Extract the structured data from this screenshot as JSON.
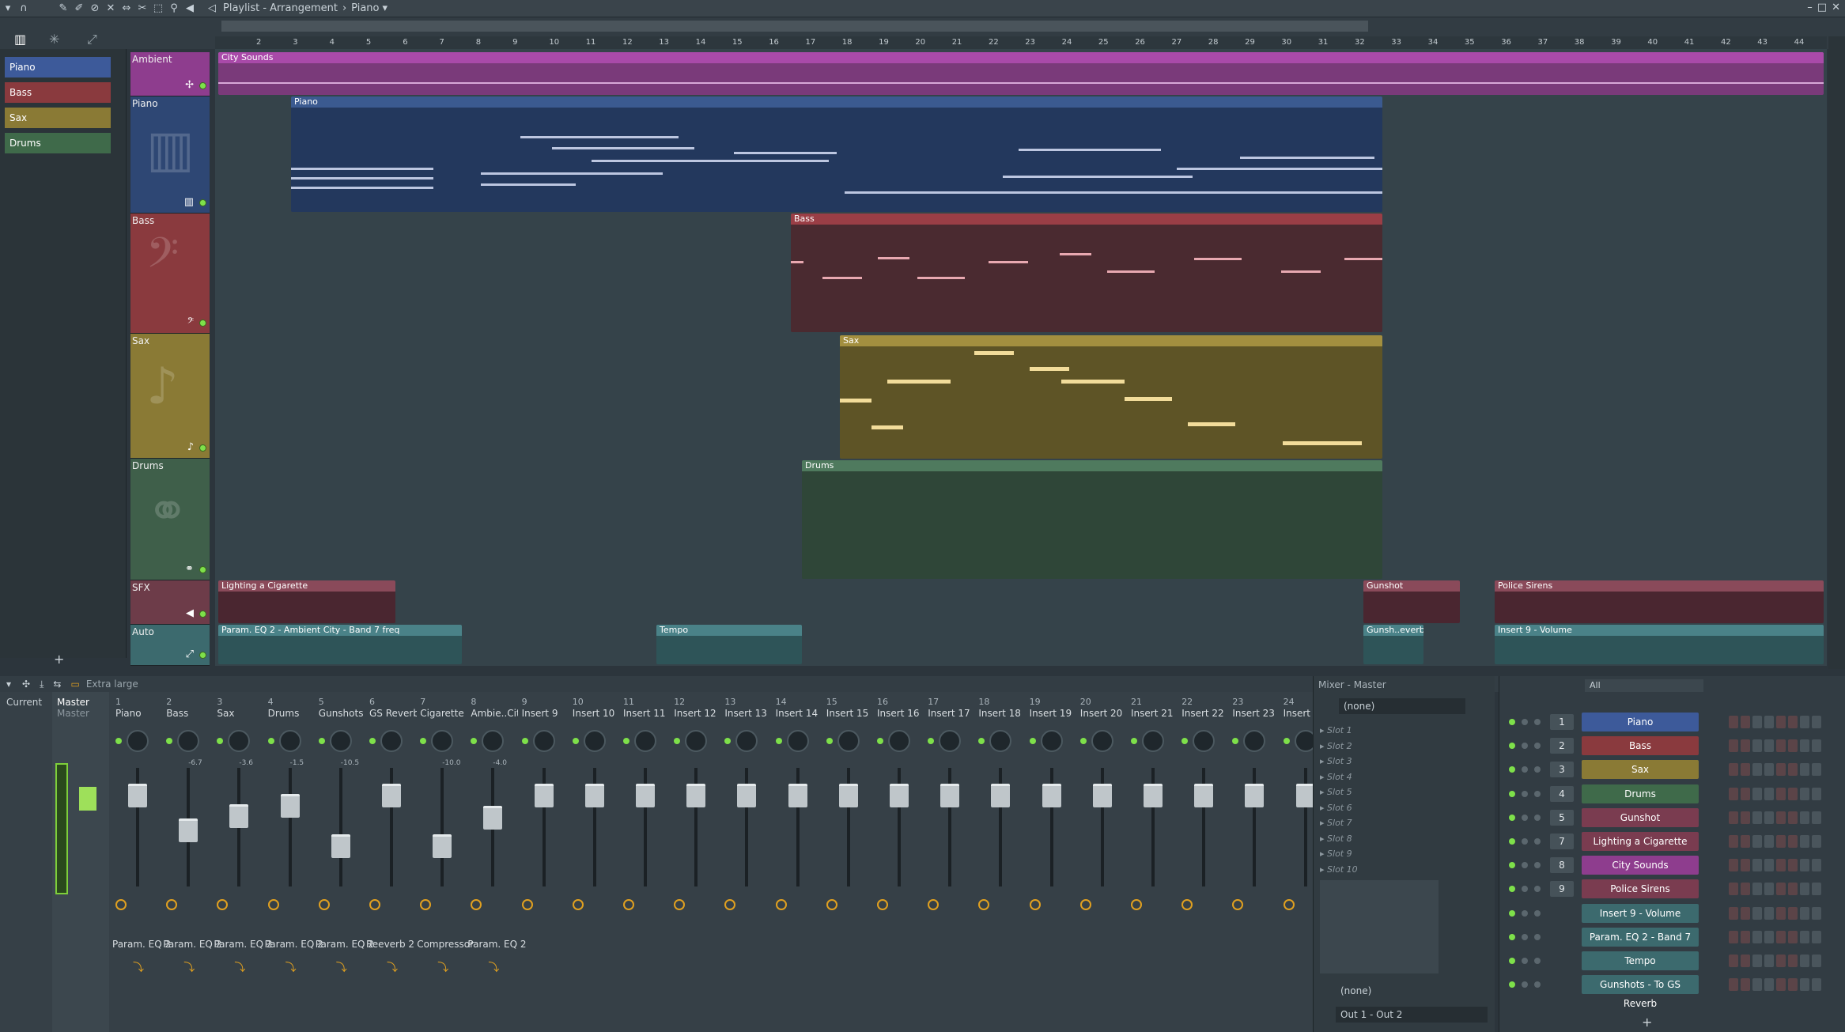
{
  "window": {
    "title": "Playlist - Arrangement",
    "pattern": "Piano"
  },
  "colors": {
    "ambient": "#8e3d8e",
    "piano": "#2e4774",
    "bass": "#8a3a3e",
    "sax": "#8a7a35",
    "drums": "#3f5f4a",
    "sfx": "#6d3c49",
    "auto": "#3c6a6e"
  },
  "picker": {
    "items": [
      {
        "label": "Piano"
      },
      {
        "label": "Bass"
      },
      {
        "label": "Sax"
      },
      {
        "label": "Drums"
      }
    ],
    "add": "+"
  },
  "ruler": {
    "bars": [
      "2",
      "3",
      "4",
      "5",
      "6",
      "7",
      "8",
      "9",
      "10",
      "11",
      "12",
      "13",
      "14",
      "15",
      "16",
      "17",
      "18",
      "19",
      "20",
      "21",
      "22",
      "23",
      "24",
      "25",
      "26",
      "27",
      "28",
      "29",
      "30",
      "31",
      "32",
      "33",
      "34",
      "35",
      "36",
      "37",
      "38",
      "39",
      "40",
      "41",
      "42",
      "43",
      "44"
    ]
  },
  "tracks": [
    {
      "name": "Ambient"
    },
    {
      "name": "Piano"
    },
    {
      "name": "Bass"
    },
    {
      "name": "Sax"
    },
    {
      "name": "Drums"
    },
    {
      "name": "SFX"
    },
    {
      "name": "Auto"
    }
  ],
  "clips": {
    "ambient": "City Sounds",
    "piano": "Piano",
    "bass": "Bass",
    "sax": "Sax",
    "drums": "Drums",
    "sfx1": "Lighting a Cigarette",
    "sfx2": "Gunshot",
    "sfx3": "Police Sirens",
    "auto1": "Param. EQ 2 - Ambient City - Band 7 freq",
    "auto2": "Tempo",
    "auto3": "Gunsh..everb",
    "auto4": "Insert 9 - Volume"
  },
  "bottombar": {
    "zoom": "Extra large"
  },
  "mixer": {
    "current": "Current",
    "master": "Master",
    "master_sub": "Master",
    "strips": [
      {
        "num": "1",
        "label": "Piano",
        "db": "",
        "fx": "Param. EQ 2"
      },
      {
        "num": "2",
        "label": "Bass",
        "db": "-6.7",
        "fx": "Param. EQ 2"
      },
      {
        "num": "3",
        "label": "Sax",
        "db": "-3.6",
        "fx": "Param. EQ 2"
      },
      {
        "num": "4",
        "label": "Drums",
        "db": "-1.5",
        "fx": "Param. EQ 2"
      },
      {
        "num": "5",
        "label": "Gunshots",
        "db": "-10.5",
        "fx": "Param. EQ 2"
      },
      {
        "num": "6",
        "label": "GS Reverb",
        "db": "",
        "fx": "Reeverb 2"
      },
      {
        "num": "7",
        "label": "Cigarette",
        "db": "-10.0",
        "fx": "Compressor"
      },
      {
        "num": "8",
        "label": "Ambie..City",
        "db": "-4.0",
        "fx": "Param. EQ 2"
      },
      {
        "num": "9",
        "label": "Insert 9",
        "db": "",
        "fx": ""
      },
      {
        "num": "10",
        "label": "Insert 10",
        "db": "",
        "fx": ""
      },
      {
        "num": "11",
        "label": "Insert 11",
        "db": "",
        "fx": ""
      },
      {
        "num": "12",
        "label": "Insert 12",
        "db": "",
        "fx": ""
      },
      {
        "num": "13",
        "label": "Insert 13",
        "db": "",
        "fx": ""
      },
      {
        "num": "14",
        "label": "Insert 14",
        "db": "",
        "fx": ""
      },
      {
        "num": "15",
        "label": "Insert 15",
        "db": "",
        "fx": ""
      },
      {
        "num": "16",
        "label": "Insert 16",
        "db": "",
        "fx": ""
      },
      {
        "num": "17",
        "label": "Insert 17",
        "db": "",
        "fx": ""
      },
      {
        "num": "18",
        "label": "Insert 18",
        "db": "",
        "fx": ""
      },
      {
        "num": "19",
        "label": "Insert 19",
        "db": "",
        "fx": ""
      },
      {
        "num": "20",
        "label": "Insert 20",
        "db": "",
        "fx": ""
      },
      {
        "num": "21",
        "label": "Insert 21",
        "db": "",
        "fx": ""
      },
      {
        "num": "22",
        "label": "Insert 22",
        "db": "",
        "fx": ""
      },
      {
        "num": "23",
        "label": "Insert 23",
        "db": "",
        "fx": ""
      },
      {
        "num": "24",
        "label": "Insert",
        "db": "",
        "fx": ""
      }
    ]
  },
  "master_panel": {
    "title": "Mixer - Master",
    "preset": "(none)",
    "slots": [
      "Slot 1",
      "Slot 2",
      "Slot 3",
      "Slot 4",
      "Slot 5",
      "Slot 6",
      "Slot 7",
      "Slot 8",
      "Slot 9",
      "Slot 10"
    ],
    "eq_preset": "(none)",
    "output": "Out 1 - Out 2"
  },
  "rack": {
    "filter": "All",
    "rows": [
      {
        "num": "1",
        "name": "Piano",
        "color": "#3d5a9a"
      },
      {
        "num": "2",
        "name": "Bass",
        "color": "#8a3a3e"
      },
      {
        "num": "3",
        "name": "Sax",
        "color": "#8a7a35"
      },
      {
        "num": "4",
        "name": "Drums",
        "color": "#3f6a4a"
      },
      {
        "num": "5",
        "name": "Gunshot",
        "color": "#7a3c50"
      },
      {
        "num": "7",
        "name": "Lighting a Cigarette",
        "color": "#7a3c50"
      },
      {
        "num": "8",
        "name": "City Sounds",
        "color": "#8e3d8e"
      },
      {
        "num": "9",
        "name": "Police Sirens",
        "color": "#7a3c50"
      },
      {
        "num": "",
        "name": "Insert 9 - Volume",
        "color": "#3c6a6e"
      },
      {
        "num": "",
        "name": "Param. EQ 2 - Band 7 freq",
        "color": "#3c6a6e"
      },
      {
        "num": "",
        "name": "Tempo",
        "color": "#3c6a6e"
      },
      {
        "num": "",
        "name": "Gunshots - To GS Reverb",
        "color": "#3c6a6e"
      }
    ],
    "add": "+"
  }
}
